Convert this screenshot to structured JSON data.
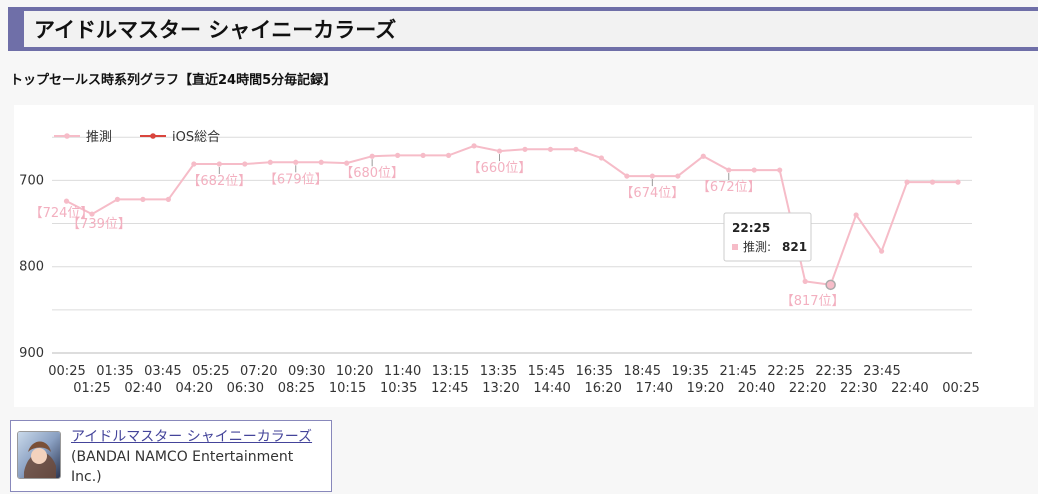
{
  "header": {
    "title": "アイドルマスター シャイニーカラーズ"
  },
  "section": {
    "subtitle": "トップセールス時系列グラフ【直近24時間5分毎記録】"
  },
  "chart_data": {
    "type": "line",
    "title": "",
    "y_inverted": true,
    "ylim": [
      630,
      900
    ],
    "yticks": [
      700,
      800,
      900
    ],
    "grid": true,
    "legend_position": "top-left",
    "legend": [
      "推測",
      "iOS総合"
    ],
    "x_labels_row1": [
      "00:25",
      "01:35",
      "03:45",
      "05:25",
      "07:20",
      "09:30",
      "10:20",
      "11:40",
      "13:15",
      "13:35",
      "15:45",
      "16:35",
      "18:45",
      "19:35",
      "21:45",
      "22:25",
      "22:35",
      "23:45"
    ],
    "x_labels_row2": [
      "01:25",
      "02:40",
      "04:20",
      "06:30",
      "08:25",
      "10:15",
      "10:35",
      "12:45",
      "13:20",
      "14:40",
      "16:20",
      "17:40",
      "19:20",
      "20:40",
      "22:20",
      "22:30",
      "22:40",
      "00:25"
    ],
    "series": [
      {
        "name": "推測",
        "color": "#f6bcc8",
        "values": [
          724,
          739,
          722,
          722,
          722,
          681,
          681,
          681,
          679,
          679,
          679,
          680,
          672,
          671,
          671,
          671,
          660,
          666,
          664,
          664,
          664,
          674,
          695,
          695,
          695,
          672,
          688,
          688,
          688,
          817,
          821,
          740,
          782,
          702,
          702,
          702
        ]
      },
      {
        "name": "iOS総合",
        "color": "#d9453d",
        "values": []
      }
    ],
    "annotations": [
      {
        "index": 0,
        "text": "【724位】"
      },
      {
        "index": 1,
        "text": "【739位】"
      },
      {
        "index": 6,
        "text": "【682位】"
      },
      {
        "index": 9,
        "text": "【679位】"
      },
      {
        "index": 12,
        "text": "【680位】"
      },
      {
        "index": 17,
        "text": "【660位】"
      },
      {
        "index": 23,
        "text": "【674位】"
      },
      {
        "index": 26,
        "text": "【672位】"
      },
      {
        "index": 30,
        "text": "【817位】"
      }
    ],
    "tooltip": {
      "index": 30,
      "time": "22:25",
      "series": "推測",
      "value": "821"
    }
  },
  "app": {
    "name": "アイドルマスター シャイニーカラーズ",
    "publisher": " (BANDAI NAMCO Entertainment Inc.)"
  }
}
